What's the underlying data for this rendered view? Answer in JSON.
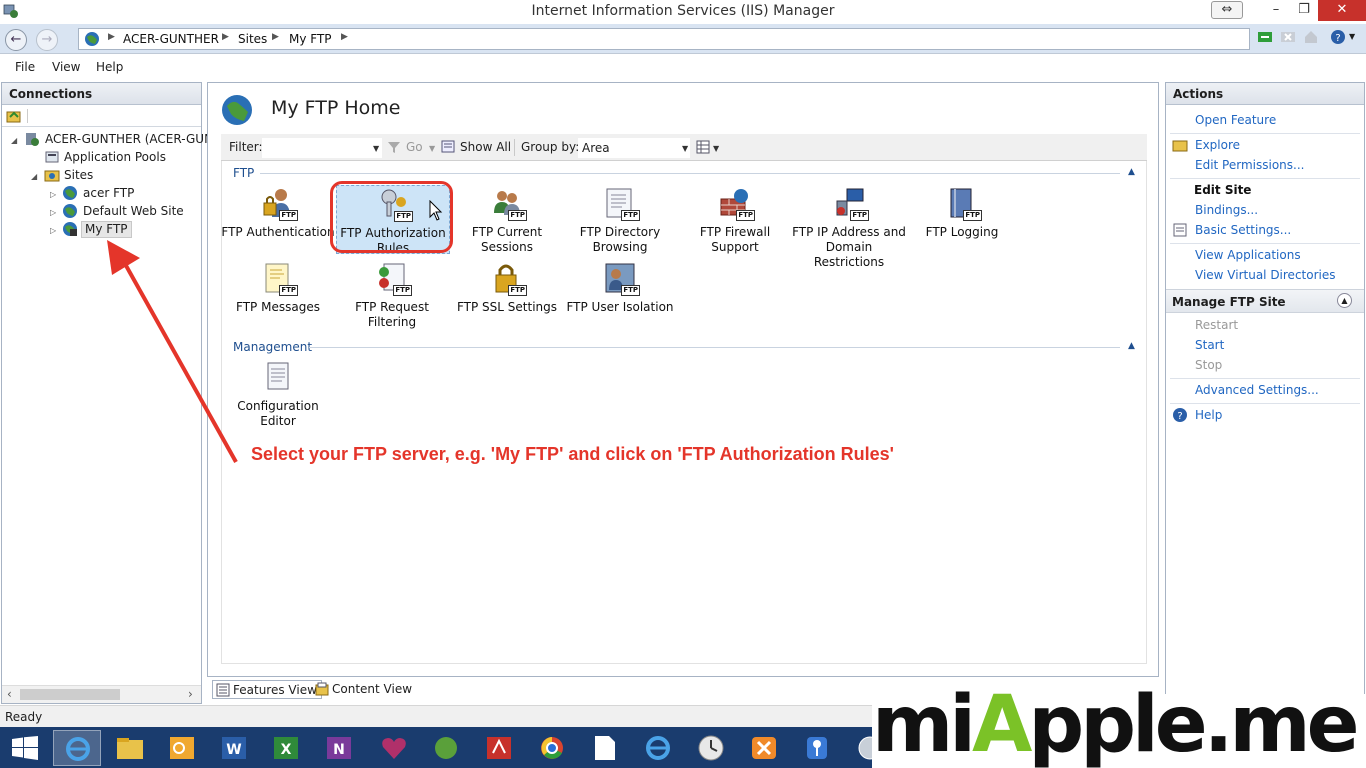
{
  "window": {
    "title": "Internet Information Services (IIS) Manager"
  },
  "address": {
    "crumbs": [
      "ACER-GUNTHER",
      "Sites",
      "My FTP"
    ]
  },
  "menu": [
    "File",
    "View",
    "Help"
  ],
  "connections": {
    "header": "Connections",
    "tree": [
      {
        "label": "ACER-GUNTHER (ACER-GUN",
        "level": 0
      },
      {
        "label": "Application Pools",
        "level": 1
      },
      {
        "label": "Sites",
        "level": 1
      },
      {
        "label": "acer FTP",
        "level": 2
      },
      {
        "label": "Default Web Site",
        "level": 2
      },
      {
        "label": "My FTP",
        "level": 2
      }
    ]
  },
  "center": {
    "title": "My FTP Home",
    "filter_label": "Filter:",
    "go_label": "Go",
    "show_all_label": "Show All",
    "group_by_label": "Group by:",
    "group_by_value": "Area",
    "groups": [
      {
        "name": "FTP",
        "features": [
          {
            "label": "FTP Authentication"
          },
          {
            "label": "FTP Authorization Rules"
          },
          {
            "label": "FTP Current Sessions"
          },
          {
            "label": "FTP Directory Browsing"
          },
          {
            "label": "FTP Firewall Support"
          },
          {
            "label": "FTP IP Address and Domain Restrictions"
          },
          {
            "label": "FTP Logging"
          },
          {
            "label": "FTP Messages"
          },
          {
            "label": "FTP Request Filtering"
          },
          {
            "label": "FTP SSL Settings"
          },
          {
            "label": "FTP User Isolation"
          }
        ]
      },
      {
        "name": "Management",
        "features": [
          {
            "label": "Configuration Editor"
          }
        ]
      }
    ],
    "ftp_tag": "FTP",
    "view_tabs": [
      "Features View",
      "Content View"
    ]
  },
  "annotation": "Select your FTP server, e.g. 'My FTP' and click on 'FTP Authorization Rules'",
  "actions": {
    "header": "Actions",
    "open_feature": "Open Feature",
    "explore": "Explore",
    "edit_permissions": "Edit Permissions...",
    "edit_site": "Edit Site",
    "bindings": "Bindings...",
    "basic_settings": "Basic Settings...",
    "view_applications": "View Applications",
    "view_virtual_directories": "View Virtual Directories",
    "manage_ftp_site": "Manage FTP Site",
    "restart": "Restart",
    "start": "Start",
    "stop": "Stop",
    "advanced_settings": "Advanced Settings...",
    "help": "Help"
  },
  "status": "Ready",
  "watermark": {
    "pre": "mi",
    "accent": "A",
    "post": "pple.me"
  },
  "colors": {
    "accent_red": "#e4352a",
    "link_blue": "#2167c2",
    "taskbar": "#1a3c6e",
    "watermark_green": "#7bc227"
  }
}
